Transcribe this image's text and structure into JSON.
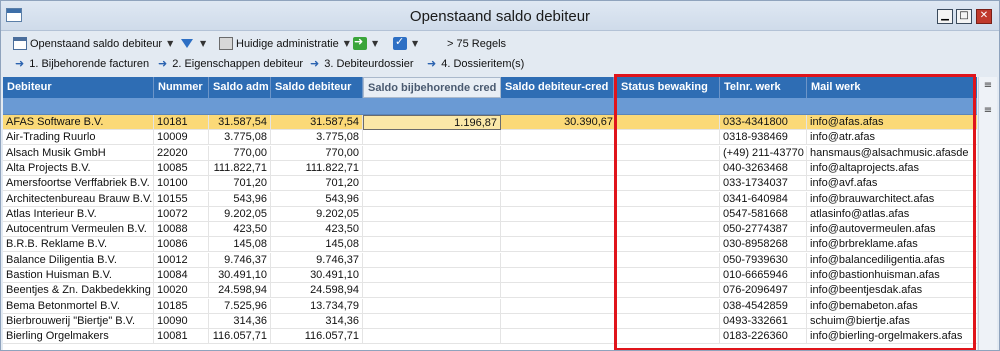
{
  "window": {
    "title": "Openstaand saldo debiteur"
  },
  "toolbar": {
    "view_label": "Openstaand saldo debiteur",
    "admin_label": "Huidige administratie",
    "rows_label": "> 75 Regels"
  },
  "actions": [
    {
      "label": "1. Bijbehorende facturen"
    },
    {
      "label": "2. Eigenschappen debiteur"
    },
    {
      "label": "3. Debiteurdossier"
    },
    {
      "label": "4. Dossieritem(s)"
    }
  ],
  "columns": [
    "Debiteur",
    "Nummer",
    "Saldo adm",
    "Saldo debiteur",
    "Saldo bijbehorende cred",
    "Saldo  debiteur-cred",
    "Status bewaking",
    "Telnr. werk",
    "Mail werk"
  ],
  "rows": [
    {
      "debiteur": "AFAS Software B.V.",
      "nummer": "10181",
      "saldo_adm": "31.587,54",
      "saldo_debiteur": "31.587,54",
      "saldo_cred": "1.196,87",
      "saldo_deb_cred": "30.390,67",
      "status": "",
      "telnr": "033-4341800",
      "mail": "info@afas.afas"
    },
    {
      "debiteur": "Air-Trading Ruurlo",
      "nummer": "10009",
      "saldo_adm": "3.775,08",
      "saldo_debiteur": "3.775,08",
      "saldo_cred": "",
      "saldo_deb_cred": "",
      "status": "",
      "telnr": "0318-938469",
      "mail": "info@atr.afas"
    },
    {
      "debiteur": "Alsach Musik GmbH",
      "nummer": "22020",
      "saldo_adm": "770,00",
      "saldo_debiteur": "770,00",
      "saldo_cred": "",
      "saldo_deb_cred": "",
      "status": "",
      "telnr": "(+49) 211-43770",
      "mail": "hansmaus@alsachmusic.afasde"
    },
    {
      "debiteur": "Alta Projects B.V.",
      "nummer": "10085",
      "saldo_adm": "111.822,71",
      "saldo_debiteur": "111.822,71",
      "saldo_cred": "",
      "saldo_deb_cred": "",
      "status": "",
      "telnr": "040-3263468",
      "mail": "info@altaprojects.afas"
    },
    {
      "debiteur": "Amersfoortse Verffabriek B.V.",
      "nummer": "10100",
      "saldo_adm": "701,20",
      "saldo_debiteur": "701,20",
      "saldo_cred": "",
      "saldo_deb_cred": "",
      "status": "",
      "telnr": "033-1734037",
      "mail": "info@avf.afas"
    },
    {
      "debiteur": "Architectenbureau Brauw B.V.",
      "nummer": "10155",
      "saldo_adm": "543,96",
      "saldo_debiteur": "543,96",
      "saldo_cred": "",
      "saldo_deb_cred": "",
      "status": "",
      "telnr": "0341-640984",
      "mail": "info@brauwarchitect.afas"
    },
    {
      "debiteur": "Atlas Interieur B.V.",
      "nummer": "10072",
      "saldo_adm": "9.202,05",
      "saldo_debiteur": "9.202,05",
      "saldo_cred": "",
      "saldo_deb_cred": "",
      "status": "",
      "telnr": "0547-581668",
      "mail": "atlasinfo@atlas.afas"
    },
    {
      "debiteur": "Autocentrum Vermeulen B.V.",
      "nummer": "10088",
      "saldo_adm": "423,50",
      "saldo_debiteur": "423,50",
      "saldo_cred": "",
      "saldo_deb_cred": "",
      "status": "",
      "telnr": "050-2774387",
      "mail": "info@autovermeulen.afas"
    },
    {
      "debiteur": "B.R.B. Reklame B.V.",
      "nummer": "10086",
      "saldo_adm": "145,08",
      "saldo_debiteur": "145,08",
      "saldo_cred": "",
      "saldo_deb_cred": "",
      "status": "",
      "telnr": "030-8958268",
      "mail": "info@brbreklame.afas"
    },
    {
      "debiteur": "Balance Diligentia B.V.",
      "nummer": "10012",
      "saldo_adm": "9.746,37",
      "saldo_debiteur": "9.746,37",
      "saldo_cred": "",
      "saldo_deb_cred": "",
      "status": "",
      "telnr": "050-7939630",
      "mail": "info@balancediligentia.afas"
    },
    {
      "debiteur": "Bastion Huisman B.V.",
      "nummer": "10084",
      "saldo_adm": "30.491,10",
      "saldo_debiteur": "30.491,10",
      "saldo_cred": "",
      "saldo_deb_cred": "",
      "status": "",
      "telnr": "010-6665946",
      "mail": "info@bastionhuisman.afas"
    },
    {
      "debiteur": "Beentjes & Zn. Dakbedekking",
      "nummer": "10020",
      "saldo_adm": "24.598,94",
      "saldo_debiteur": "24.598,94",
      "saldo_cred": "",
      "saldo_deb_cred": "",
      "status": "",
      "telnr": "076-2096497",
      "mail": "info@beentjesdak.afas"
    },
    {
      "debiteur": "Bema Betonmortel B.V.",
      "nummer": "10185",
      "saldo_adm": "7.525,96",
      "saldo_debiteur": "13.734,79",
      "saldo_cred": "",
      "saldo_deb_cred": "",
      "status": "",
      "telnr": "038-4542859",
      "mail": "info@bemabeton.afas"
    },
    {
      "debiteur": "Bierbrouwerij \"Biertje\" B.V.",
      "nummer": "10090",
      "saldo_adm": "314,36",
      "saldo_debiteur": "314,36",
      "saldo_cred": "",
      "saldo_deb_cred": "",
      "status": "",
      "telnr": "0493-332661",
      "mail": "schuim@biertje.afas"
    },
    {
      "debiteur": "Bierling Orgelmakers",
      "nummer": "10081",
      "saldo_adm": "116.057,71",
      "saldo_debiteur": "116.057,71",
      "saldo_cred": "",
      "saldo_deb_cred": "",
      "status": "",
      "telnr": "0183-226360",
      "mail": "info@bierling-orgelmakers.afas"
    }
  ],
  "colors": {
    "header": "#2e6db4",
    "filter_row": "#6a9ad4",
    "selected_row": "#fbd977",
    "highlight": "#e0141b"
  },
  "icons": {
    "view": "grid-icon",
    "filter": "filter-icon",
    "admin": "admin-icon",
    "export": "arrow-right-icon",
    "check": "checkbox-icon",
    "action": "arrow-right-icon"
  }
}
